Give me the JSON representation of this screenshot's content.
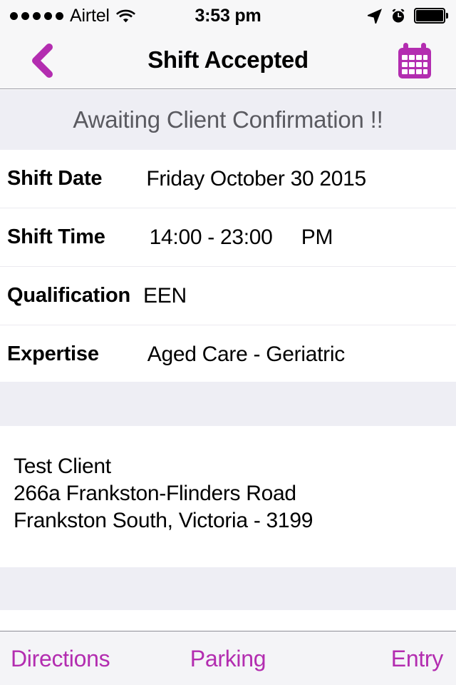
{
  "status_bar": {
    "signal_dots": 5,
    "carrier": "Airtel",
    "wifi_icon": "wifi-icon",
    "time": "3:53 pm",
    "location_icon": "location-arrow-icon",
    "alarm_icon": "alarm-clock-icon",
    "battery_icon": "battery-full-icon"
  },
  "nav": {
    "back_icon": "back-chevron-icon",
    "title": "Shift Accepted",
    "calendar_icon": "calendar-icon"
  },
  "banner": {
    "text": "Awaiting Client Confirmation !!"
  },
  "details": [
    {
      "label": "Shift Date",
      "value": "Friday October 30 2015"
    },
    {
      "label": "Shift Time",
      "value": "14:00 - 23:00     PM"
    },
    {
      "label": "Qualification",
      "value": "EEN"
    },
    {
      "label": "Expertise",
      "value": "Aged Care - Geriatric"
    }
  ],
  "address": {
    "line1": "Test Client",
    "line2": "266a Frankston-Flinders Road",
    "line3": "Frankston South, Victoria - 3199"
  },
  "toolbar": {
    "directions": "Directions",
    "parking": "Parking",
    "entry": "Entry"
  },
  "colors": {
    "accent_purple": "#b32db0",
    "banner_bg": "#eeeef4",
    "banner_text": "#5a5a60",
    "chrome_bg": "#f7f7f8",
    "toolbar_bg": "#f4f4f7"
  }
}
